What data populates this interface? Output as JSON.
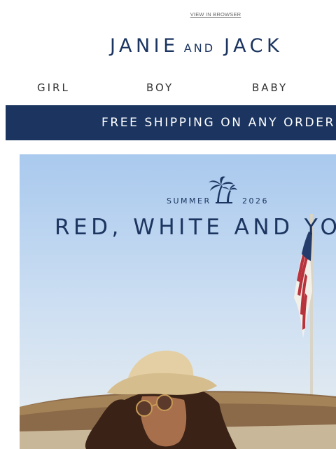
{
  "header": {
    "view_in_browser": "VIEW IN BROWSER",
    "logo_main_left": "JANIE",
    "logo_connector": "AND",
    "logo_main_right": "JACK"
  },
  "nav": {
    "items": [
      {
        "label": "GIRL"
      },
      {
        "label": "BOY"
      },
      {
        "label": "BABY"
      }
    ]
  },
  "banner": {
    "text": "FREE SHIPPING ON ANY ORDER"
  },
  "hero": {
    "season_label": "SUMMER",
    "season_year": "2026",
    "headline": "RED, WHITE AND YOU",
    "colors": {
      "navy": "#1b3560",
      "sky_top": "#a9c9ee",
      "sky_bottom": "#e4edf3"
    }
  }
}
